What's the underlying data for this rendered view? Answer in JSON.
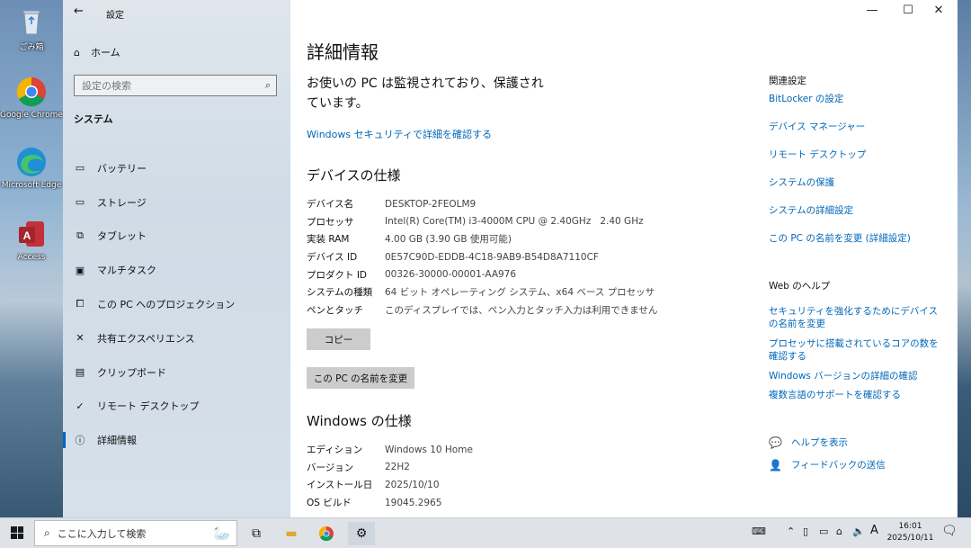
{
  "desktop": {
    "icons": [
      {
        "label": "ごみ箱",
        "icon": "recycle-bin-icon"
      },
      {
        "label": "Google Chrome",
        "icon": "chrome-icon"
      },
      {
        "label": "Microsoft Edge",
        "icon": "edge-icon"
      },
      {
        "label": "Access",
        "icon": "access-icon"
      }
    ]
  },
  "window": {
    "app_title": "設定",
    "controls": {
      "minimize": "—",
      "maximize": "☐",
      "close": "✕"
    }
  },
  "sidebar": {
    "home_label": "ホーム",
    "search_placeholder": "設定の検索",
    "section": "システム",
    "items": [
      {
        "label": "バッテリー",
        "icon": "battery-icon"
      },
      {
        "label": "ストレージ",
        "icon": "storage-icon"
      },
      {
        "label": "タブレット",
        "icon": "tablet-icon"
      },
      {
        "label": "マルチタスク",
        "icon": "multitask-icon"
      },
      {
        "label": "この PC へのプロジェクション",
        "icon": "projection-icon"
      },
      {
        "label": "共有エクスペリエンス",
        "icon": "shared-experiences-icon"
      },
      {
        "label": "クリップボード",
        "icon": "clipboard-icon"
      },
      {
        "label": "リモート デスクトップ",
        "icon": "remote-desktop-icon"
      },
      {
        "label": "詳細情報",
        "icon": "info-icon",
        "active": true
      }
    ]
  },
  "main": {
    "title": "詳細情報",
    "monitor_text": "お使いの PC は監視されており、保護されています。",
    "security_link": "Windows セキュリティで詳細を確認する",
    "device_heading": "デバイスの仕様",
    "device_specs": [
      {
        "key": "デバイス名",
        "value": "DESKTOP-2FEOLM9"
      },
      {
        "key": "プロセッサ",
        "value": "Intel(R) Core(TM) i3-4000M CPU @ 2.40GHz   2.40 GHz"
      },
      {
        "key": "実装 RAM",
        "value": "4.00 GB (3.90 GB 使用可能)"
      },
      {
        "key": "デバイス ID",
        "value": "0E57C90D-EDDB-4C18-9AB9-B54D8A7110CF"
      },
      {
        "key": "プロダクト ID",
        "value": "00326-30000-00001-AA976"
      },
      {
        "key": "システムの種類",
        "value": "64 ビット オペレーティング システム、x64 ベース プロセッサ"
      },
      {
        "key": "ペンとタッチ",
        "value": "このディスプレイでは、ペン入力とタッチ入力は利用できません"
      }
    ],
    "copy_button": "コピー",
    "rename_button": "この PC の名前を変更",
    "windows_heading": "Windows の仕様",
    "windows_specs": [
      {
        "key": "エディション",
        "value": "Windows 10 Home"
      },
      {
        "key": "バージョン",
        "value": "22H2"
      },
      {
        "key": "インストール日",
        "value": "2025/10/10"
      },
      {
        "key": "OS ビルド",
        "value": "19045.2965"
      }
    ]
  },
  "related": {
    "heading": "関連設定",
    "links": [
      "BitLocker の設定",
      "デバイス マネージャー",
      "リモート デスクトップ",
      "システムの保護",
      "システムの詳細設定",
      "この PC の名前を変更 (詳細設定)"
    ],
    "web_help_heading": "Web のヘルプ",
    "web_links": [
      "セキュリティを強化するためにデバイスの名前を変更",
      "プロセッサに搭載されているコアの数を確認する",
      "Windows バージョンの詳細の確認",
      "複数言語のサポートを確認する"
    ],
    "help_label": "ヘルプを表示",
    "feedback_label": "フィードバックの送信"
  },
  "taskbar": {
    "search_placeholder": "ここに入力して検索",
    "ime": "A",
    "time": "16:01",
    "date": "2025/10/11"
  },
  "colors": {
    "link": "#0067b8",
    "accent": "#0067c0"
  }
}
